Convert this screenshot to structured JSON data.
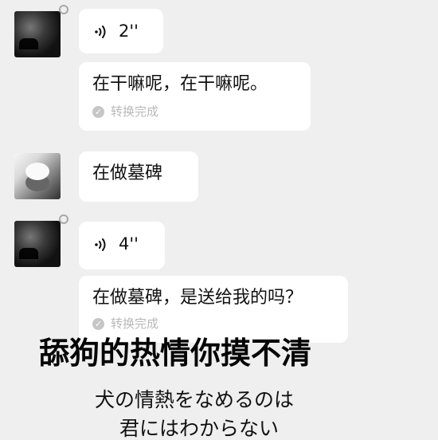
{
  "chat": {
    "messages": [
      {
        "duration": "2''"
      },
      {
        "text": "在干嘛呢，在干嘛呢。",
        "status": "转换完成"
      },
      {
        "text": "在做墓碑"
      },
      {
        "duration": "4''"
      },
      {
        "text": "在做墓碑，是送给我的吗？",
        "status": "转换完成"
      }
    ]
  },
  "caption": {
    "main": "舔狗的热情你摸不清",
    "sub1": "犬の情熱をなめるのは",
    "sub2": "君にはわからない"
  },
  "icons": {
    "voice": "voice-wave-icon",
    "check": "check-circle-icon",
    "status_dot": "status-dot-icon"
  },
  "colors": {
    "background": "#efefef",
    "bubble": "#ffffff",
    "status_text": "#b8b8b8",
    "caption_text": "#050505"
  }
}
